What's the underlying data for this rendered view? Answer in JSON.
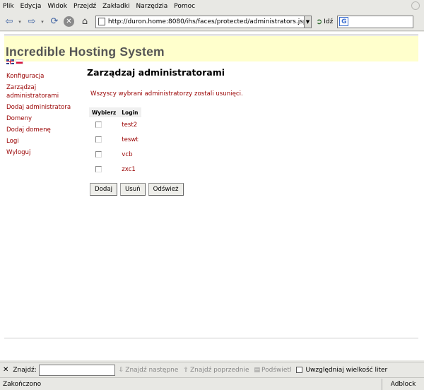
{
  "browser": {
    "menu": [
      {
        "label": "Plik"
      },
      {
        "label": "Edycja"
      },
      {
        "label": "Widok"
      },
      {
        "label": "Przejdź"
      },
      {
        "label": "Zakładki"
      },
      {
        "label": "Narzędzia"
      },
      {
        "label": "Pomoc"
      }
    ],
    "url": "http://duron.home:8080/ihs/faces/protected/administrators.jsp",
    "go_label": "Idź",
    "search_placeholder": ""
  },
  "app": {
    "title": "Incredible Hosting System",
    "sidebar": [
      {
        "label": "Konfiguracja"
      },
      {
        "label": "Zarządzaj administratorami"
      },
      {
        "label": "Dodaj administratora"
      },
      {
        "label": "Domeny"
      },
      {
        "label": "Dodaj domenę"
      },
      {
        "label": "Logi"
      },
      {
        "label": "Wyloguj"
      }
    ],
    "heading": "Zarządzaj administratorami",
    "message": "Wszyscy wybrani administratorzy zostali usunięci.",
    "table": {
      "headers": [
        "Wybierz",
        "Login"
      ],
      "rows": [
        {
          "login": "test2",
          "checked": false
        },
        {
          "login": "teswt",
          "checked": false
        },
        {
          "login": "vcb",
          "checked": false
        },
        {
          "login": "zxc1",
          "checked": false
        }
      ]
    },
    "buttons": {
      "add": "Dodaj",
      "remove": "Usuń",
      "refresh": "Odśwież"
    }
  },
  "findbar": {
    "label": "Znajdź:",
    "value": "",
    "next": "Znajdź następne",
    "prev": "Znajdź poprzednie",
    "highlight": "Podświetl",
    "match_case": "Uwzględniaj wielkość liter"
  },
  "status": {
    "text": "Zakończono",
    "adblock": "Adblock"
  }
}
